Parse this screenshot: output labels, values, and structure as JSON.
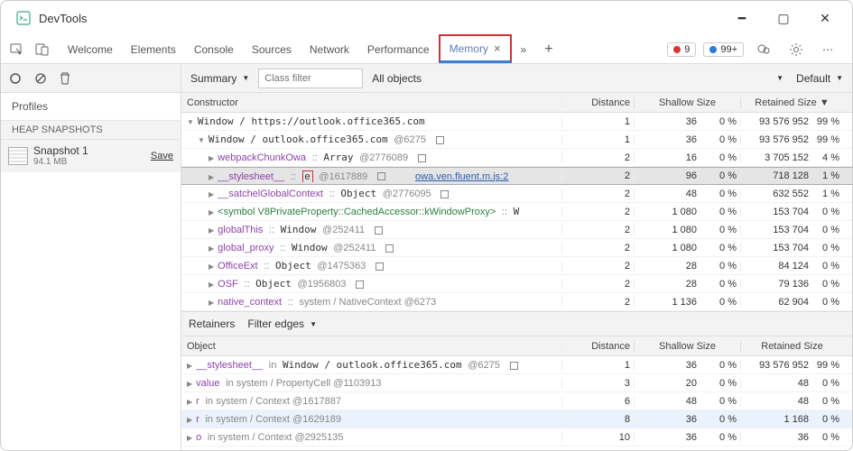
{
  "title": "DevTools",
  "tabs": {
    "welcome": "Welcome",
    "elements": "Elements",
    "console": "Console",
    "sources": "Sources",
    "network": "Network",
    "performance": "Performance",
    "memory": "Memory"
  },
  "badges": {
    "errors": "9",
    "issues": "99+"
  },
  "left": {
    "profiles": "Profiles",
    "heap": "HEAP SNAPSHOTS",
    "snapshot_name": "Snapshot 1",
    "snapshot_size": "94.1 MB",
    "save": "Save"
  },
  "filterbar": {
    "summary": "Summary",
    "class_filter_placeholder": "Class filter",
    "objects": "All objects",
    "retain": "Default"
  },
  "cols": {
    "constructor": "Constructor",
    "distance": "Distance",
    "shallow": "Shallow Size",
    "retained": "Retained Size",
    "object": "Object"
  },
  "retainers_label": "Retainers",
  "filter_edges_label": "Filter edges",
  "rows": [
    {
      "pad": 1,
      "tri": "d",
      "html": "Window / https://outlook.office365.com",
      "d": "1",
      "sa": "36",
      "sb": "0 %",
      "ra": "93 576 952",
      "rb": "99 %"
    },
    {
      "pad": 2,
      "tri": "d",
      "html": "Window / outlook.office365.com <span class='gray'>@6275</span> <span class='sq'></span>",
      "d": "1",
      "sa": "36",
      "sb": "0 %",
      "ra": "93 576 952",
      "rb": "99 %"
    },
    {
      "pad": 3,
      "tri": "r",
      "html": "<span class='purple'>webpackChunkOwa</span> <span class='gray'>::</span> Array <span class='gray'>@2776089</span> <span class='sq'></span>",
      "d": "2",
      "sa": "16",
      "sb": "0 %",
      "ra": "3 705 152",
      "rb": "4 %"
    },
    {
      "pad": 3,
      "tri": "r",
      "sel": true,
      "html": "<span class='purple'>__stylesheet__</span> <span class='gray'>::</span> <span class='redbox'>e</span> <span class='gray'>@1617889</span> <span class='sq'></span>&nbsp;&nbsp;&nbsp;&nbsp;&nbsp;<span class='link'>owa.ven.fluent.m.js:2</span>",
      "d": "2",
      "sa": "96",
      "sb": "0 %",
      "ra": "718 128",
      "rb": "1 %"
    },
    {
      "pad": 3,
      "tri": "r",
      "html": "<span class='purple'>__satchelGlobalContext</span> <span class='gray'>::</span> Object <span class='gray'>@2776095</span> <span class='sq'></span>",
      "d": "2",
      "sa": "48",
      "sb": "0 %",
      "ra": "632 552",
      "rb": "1 %"
    },
    {
      "pad": 3,
      "tri": "r",
      "html": "<span class='green'>&lt;symbol V8PrivateProperty::CachedAccessor::kWindowProxy&gt;</span> <span class='gray'>::</span> W",
      "d": "2",
      "sa": "1 080",
      "sb": "0 %",
      "ra": "153 704",
      "rb": "0 %"
    },
    {
      "pad": 3,
      "tri": "r",
      "html": "<span class='purple'>globalThis</span> <span class='gray'>::</span> Window <span class='gray'>@252411</span> <span class='sq'></span>",
      "d": "2",
      "sa": "1 080",
      "sb": "0 %",
      "ra": "153 704",
      "rb": "0 %"
    },
    {
      "pad": 3,
      "tri": "r",
      "html": "<span class='purple'>global_proxy</span> <span class='gray'>::</span> Window <span class='gray'>@252411</span> <span class='sq'></span>",
      "d": "2",
      "sa": "1 080",
      "sb": "0 %",
      "ra": "153 704",
      "rb": "0 %"
    },
    {
      "pad": 3,
      "tri": "r",
      "html": "<span class='purple'>OfficeExt</span> <span class='gray'>::</span> Object <span class='gray'>@1475363</span> <span class='sq'></span>",
      "d": "2",
      "sa": "28",
      "sb": "0 %",
      "ra": "84 124",
      "rb": "0 %"
    },
    {
      "pad": 3,
      "tri": "r",
      "html": "<span class='purple'>OSF</span> <span class='gray'>::</span> Object <span class='gray'>@1956803</span> <span class='sq'></span>",
      "d": "2",
      "sa": "28",
      "sb": "0 %",
      "ra": "79 136",
      "rb": "0 %"
    },
    {
      "pad": 3,
      "tri": "r",
      "html": "<span class='purple'>native_context</span> <span class='gray'>::</span> <span class='gray'>system / NativeContext @6273</span>",
      "d": "2",
      "sa": "1 136",
      "sb": "0 %",
      "ra": "62 904",
      "rb": "0 %"
    }
  ],
  "retainers": [
    {
      "tri": "r",
      "html": "<span class='purple'>__stylesheet__</span> <span class='gray'>in</span> Window / outlook.office365.com <span class='gray'>@6275</span> <span class='sq'></span>",
      "d": "1",
      "sa": "36",
      "sb": "0 %",
      "ra": "93 576 952",
      "rb": "99 %"
    },
    {
      "tri": "r",
      "html": "<span class='purple'>value</span> <span class='gray'>in system / PropertyCell @1103913</span>",
      "d": "3",
      "sa": "20",
      "sb": "0 %",
      "ra": "48",
      "rb": "0 %"
    },
    {
      "tri": "r",
      "html": "<span class='purple'>r</span> <span class='gray'>in system / Context @1617887</span>",
      "d": "6",
      "sa": "48",
      "sb": "0 %",
      "ra": "48",
      "rb": "0 %"
    },
    {
      "tri": "r",
      "blue": true,
      "html": "<span class='purple'>r</span> <span class='gray'>in system / Context @1629189</span>",
      "d": "8",
      "sa": "36",
      "sb": "0 %",
      "ra": "1 168",
      "rb": "0 %"
    },
    {
      "tri": "r",
      "html": "<span class='purple'>o</span> <span class='gray'>in system / Context @2925135</span>",
      "d": "10",
      "sa": "36",
      "sb": "0 %",
      "ra": "36",
      "rb": "0 %"
    }
  ]
}
